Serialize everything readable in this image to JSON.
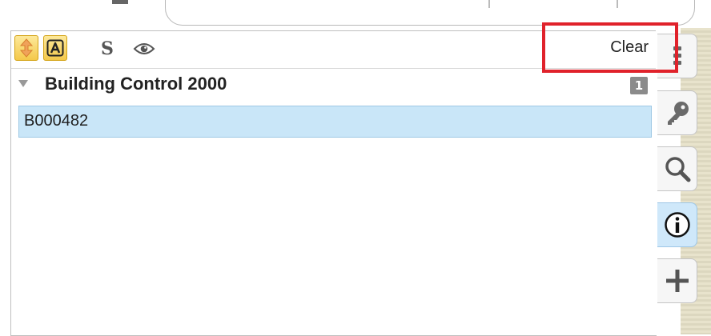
{
  "toolbar": {
    "buttons": [
      {
        "icon": "sort-arrows-icon",
        "active": true
      },
      {
        "icon": "letter-a-icon",
        "label": "A",
        "active": true
      },
      {
        "icon": "letter-s-icon",
        "label": "S",
        "active": false
      },
      {
        "icon": "eye-icon",
        "active": false
      }
    ],
    "clear_label": "Clear"
  },
  "results": {
    "group_title": "Building Control 2000",
    "group_count": "1",
    "items": [
      "B000482"
    ]
  },
  "side_tools": [
    "menu-icon",
    "key-icon",
    "search-icon",
    "info-icon",
    "plus-icon"
  ],
  "colors": {
    "highlight": "#e0222b",
    "selected_row": "#c9e6f8",
    "active_toggle": "#f4c84a"
  }
}
